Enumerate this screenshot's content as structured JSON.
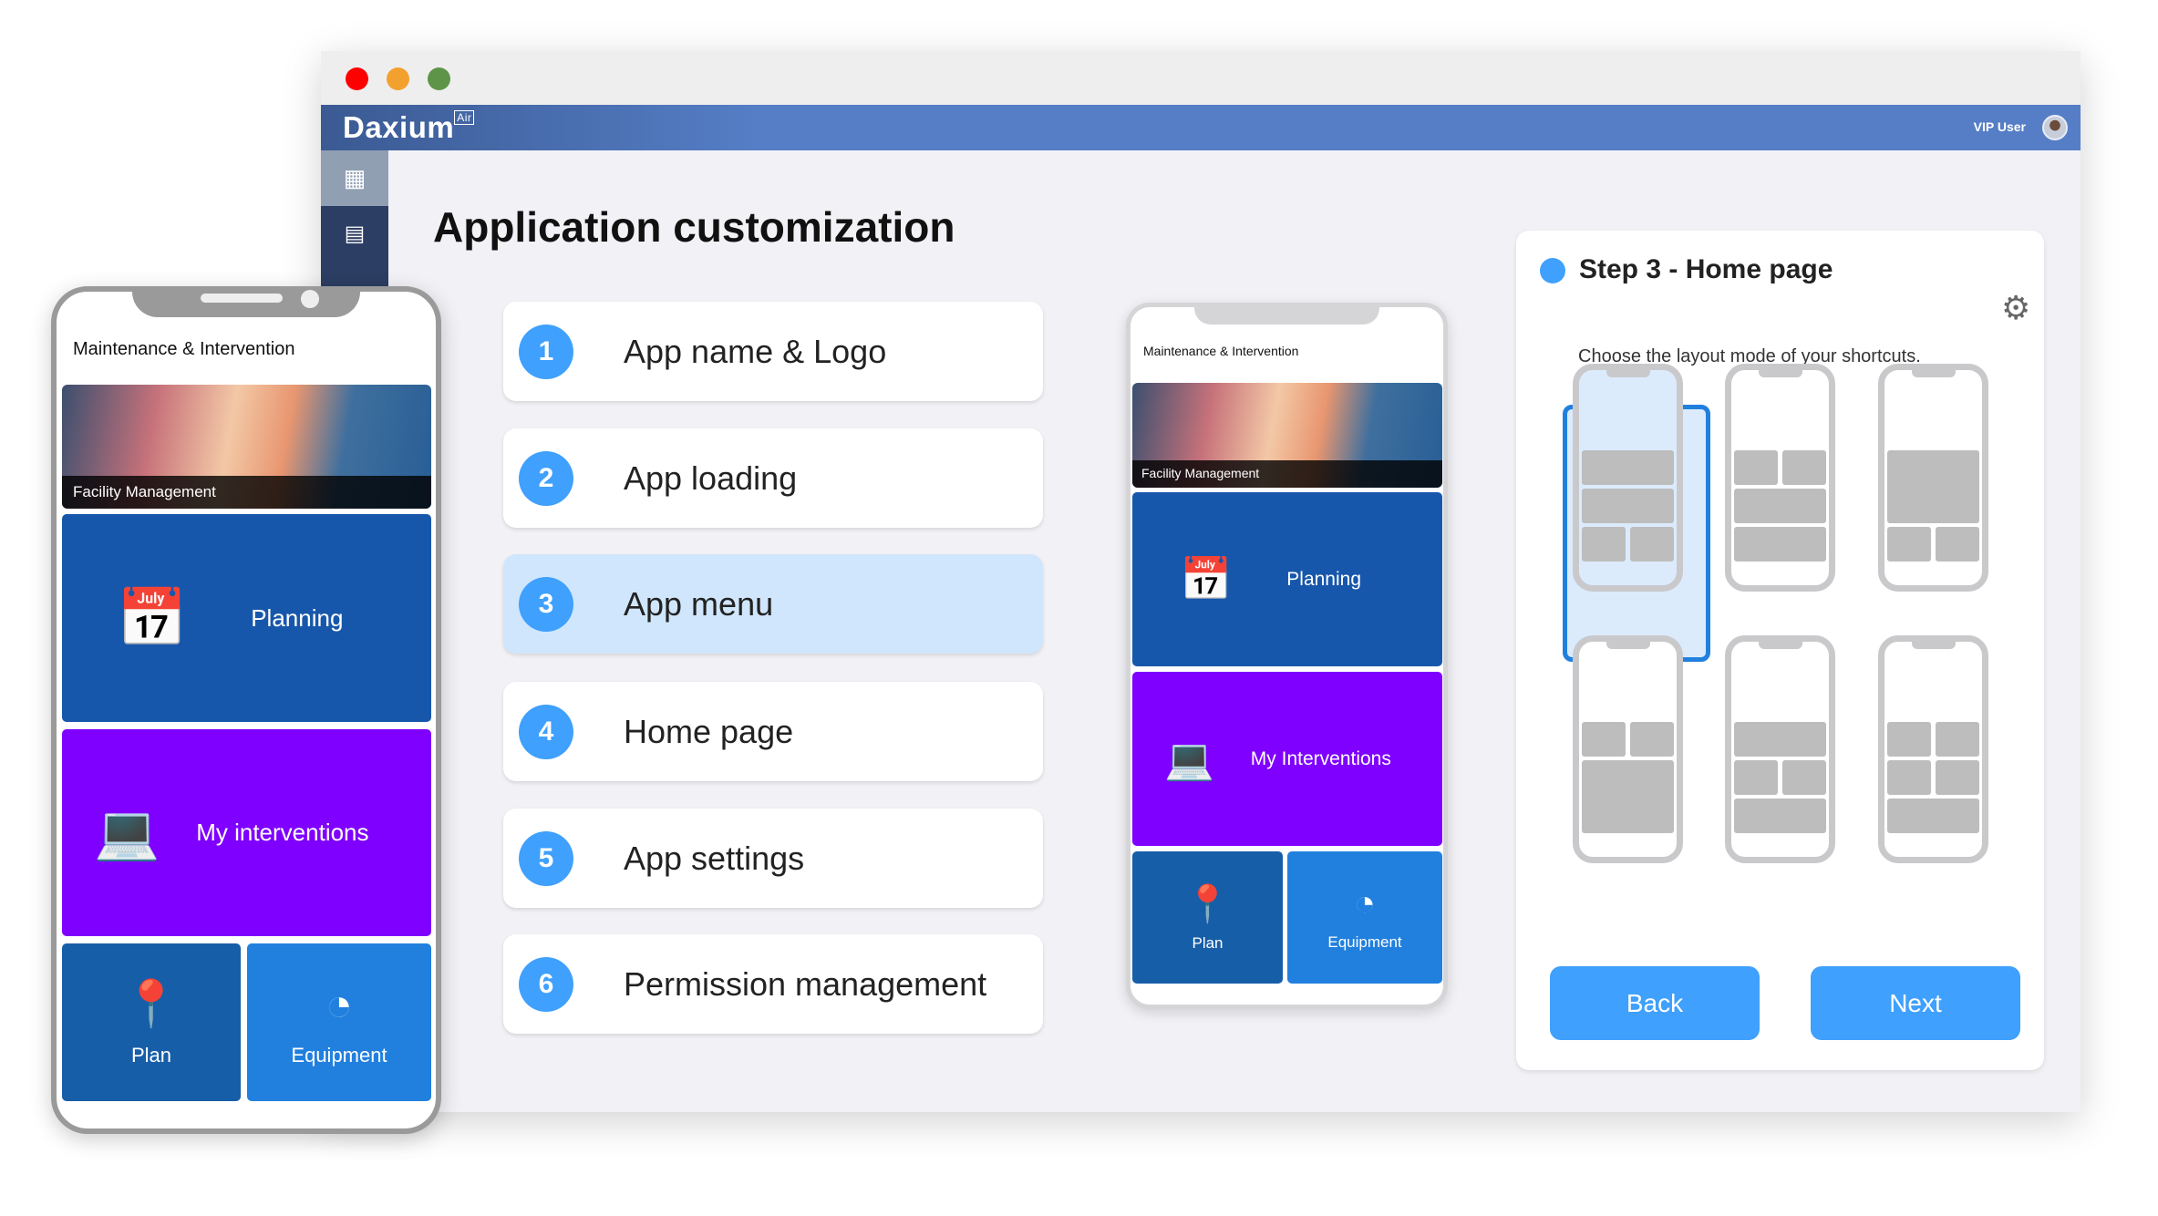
{
  "window": {
    "traffic_lights": [
      "#ff0000",
      "#f3a12e",
      "#5e9448"
    ]
  },
  "header": {
    "logo": "Daxium",
    "logo_sup": "Air",
    "user": "VIP User"
  },
  "sidebar": {
    "items": [
      {
        "icon": "grid-icon"
      },
      {
        "icon": "calendar-icon"
      }
    ]
  },
  "page": {
    "title": "Application customization"
  },
  "steps": [
    {
      "num": "1",
      "label": "App name & Logo"
    },
    {
      "num": "2",
      "label": "App loading"
    },
    {
      "num": "3",
      "label": "App menu",
      "active": true
    },
    {
      "num": "4",
      "label": "Home page"
    },
    {
      "num": "5",
      "label": "App settings"
    },
    {
      "num": "6",
      "label": "Permission management"
    }
  ],
  "phone_left": {
    "title": "Maintenance & Intervention",
    "banner": "Facility Management",
    "tiles": [
      "Planning",
      "My interventions",
      "Plan",
      "Equipment"
    ]
  },
  "phone_mid": {
    "title": "Maintenance & Intervention",
    "banner": "Facility Management",
    "tiles": [
      "Planning",
      "My Interventions",
      "Plan",
      "Equipment"
    ]
  },
  "colors": {
    "planning": "#1757ab",
    "interventions": "#7f00fe",
    "plan": "#175ea8",
    "equipment": "#2180de",
    "accent": "#3fa0fd"
  },
  "panel": {
    "title": "Step 3 - Home page",
    "subtitle": "Choose the layout mode of your shortcuts.",
    "selected_layout": 1,
    "back": "Back",
    "next": "Next"
  }
}
